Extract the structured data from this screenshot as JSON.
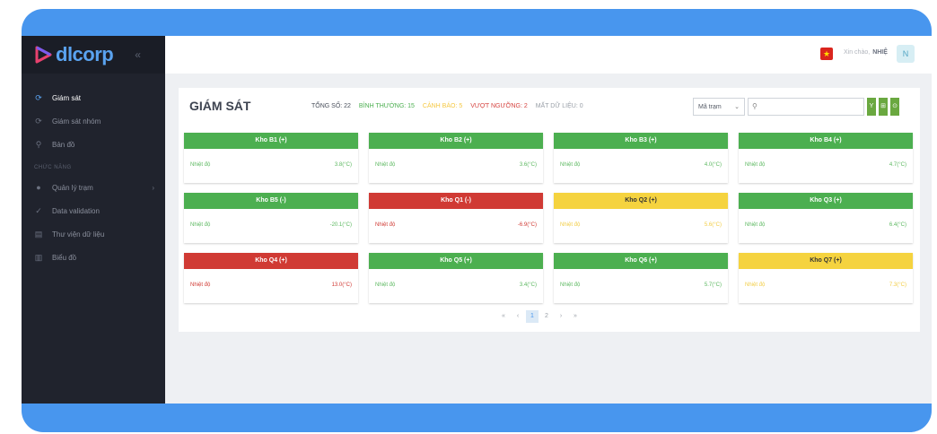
{
  "brand": {
    "logo_text": "dlcorp"
  },
  "sidebar": {
    "collapse_icon": "«",
    "items": [
      {
        "label": "Giám sát",
        "icon": "monitor-icon",
        "active": true
      },
      {
        "label": "Giám sát nhóm",
        "icon": "group-monitor-icon",
        "active": false
      },
      {
        "label": "Bản đồ",
        "icon": "map-icon",
        "active": false
      }
    ],
    "section_label": "CHỨC NĂNG",
    "function_items": [
      {
        "label": "Quản lý trạm",
        "icon": "station-icon",
        "has_children": true
      },
      {
        "label": "Data validation",
        "icon": "check-icon",
        "has_children": false
      },
      {
        "label": "Thư viện dữ liệu",
        "icon": "library-icon",
        "has_children": false
      },
      {
        "label": "Biểu đồ",
        "icon": "chart-icon",
        "has_children": false
      }
    ]
  },
  "header": {
    "greeting": "Xin chào,",
    "user": "NHIỆ",
    "avatar_letter": "N"
  },
  "page": {
    "title": "GIÁM SÁT",
    "stats": {
      "total": "TỔNG SỐ: 22",
      "normal": "BÌNH THƯỜNG: 15",
      "warning": "CẢNH BÁO: 5",
      "over": "VƯỢT NGƯỠNG: 2",
      "lost": "MẤT DỮ LIỆU: 0"
    },
    "filter_select": "Mã trạm",
    "search_placeholder": "",
    "toolbar": [
      "Y",
      "⊞",
      "⊙"
    ]
  },
  "cards": [
    {
      "name": "Kho B1 (+)",
      "label": "Nhiệt độ",
      "value": "3.8(°C)",
      "status": "green"
    },
    {
      "name": "Kho B2 (+)",
      "label": "Nhiệt độ",
      "value": "3.6(°C)",
      "status": "green"
    },
    {
      "name": "Kho B3 (+)",
      "label": "Nhiệt độ",
      "value": "4.0(°C)",
      "status": "green"
    },
    {
      "name": "Kho B4 (+)",
      "label": "Nhiệt độ",
      "value": "4.7(°C)",
      "status": "green"
    },
    {
      "name": "Kho B5 (-)",
      "label": "Nhiệt độ",
      "value": "-20.1(°C)",
      "status": "green"
    },
    {
      "name": "Kho Q1 (-)",
      "label": "Nhiệt độ",
      "value": "-6.9(°C)",
      "status": "red"
    },
    {
      "name": "Kho Q2 (+)",
      "label": "Nhiệt độ",
      "value": "5.6(°C)",
      "status": "yellow"
    },
    {
      "name": "Kho Q3 (+)",
      "label": "Nhiệt độ",
      "value": "6.4(°C)",
      "status": "green"
    },
    {
      "name": "Kho Q4 (+)",
      "label": "Nhiệt độ",
      "value": "13.0(°C)",
      "status": "red"
    },
    {
      "name": "Kho Q5 (+)",
      "label": "Nhiệt độ",
      "value": "3.4(°C)",
      "status": "green"
    },
    {
      "name": "Kho Q6 (+)",
      "label": "Nhiệt độ",
      "value": "5.7(°C)",
      "status": "green"
    },
    {
      "name": "Kho Q7 (+)",
      "label": "Nhiệt độ",
      "value": "7.3(°C)",
      "status": "yellow"
    }
  ],
  "pagination": {
    "first": "«",
    "prev": "‹",
    "pages": [
      "1",
      "2"
    ],
    "current": "1",
    "next": "›",
    "last": "»"
  }
}
